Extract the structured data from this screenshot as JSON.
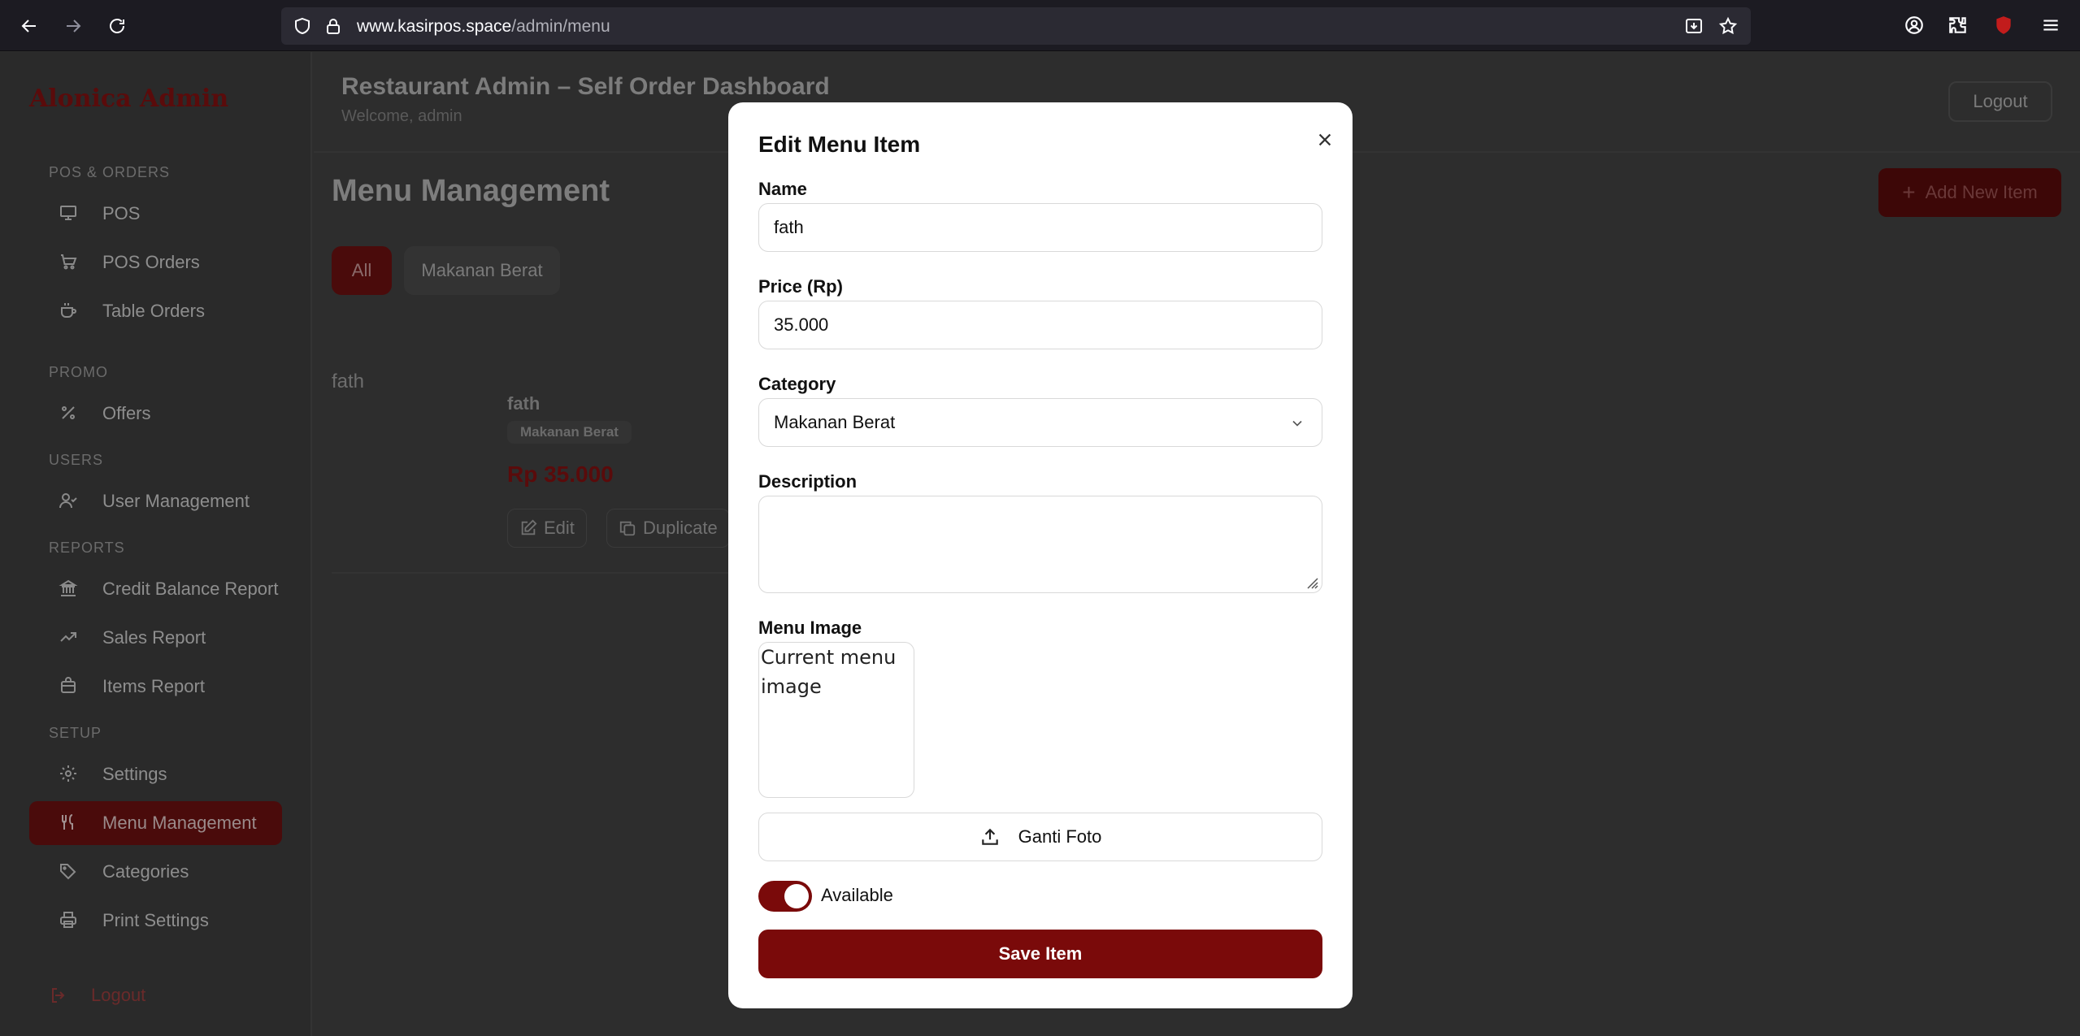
{
  "browser": {
    "url_host": "www.kasirpos.space",
    "url_path": "/admin/menu"
  },
  "sidebar": {
    "brand": "Alonica Admin",
    "sections": {
      "pos_orders": "POS & ORDERS",
      "promo": "PROMO",
      "users": "USERS",
      "reports": "REPORTS",
      "setup": "SETUP"
    },
    "items": {
      "pos": "POS",
      "pos_orders": "POS Orders",
      "table_orders": "Table Orders",
      "offers": "Offers",
      "user_management": "User Management",
      "credit_balance_report": "Credit Balance Report",
      "sales_report": "Sales Report",
      "items_report": "Items Report",
      "settings": "Settings",
      "menu_management": "Menu Management",
      "categories": "Categories",
      "print_settings": "Print Settings"
    },
    "logout": "Logout"
  },
  "header": {
    "title": "Restaurant Admin – Self Order Dashboard",
    "subtitle": "Welcome, admin",
    "logout": "Logout"
  },
  "main": {
    "title": "Menu Management",
    "add_button": "Add New Item",
    "filters": [
      "All",
      "Makanan Berat"
    ],
    "card": {
      "image_alt": "fath",
      "name": "fath",
      "category": "Makanan Berat",
      "price": "Rp 35.000",
      "edit": "Edit",
      "duplicate": "Duplicate"
    }
  },
  "modal": {
    "title": "Edit Menu Item",
    "name_label": "Name",
    "name_value": "fath",
    "price_label": "Price (Rp)",
    "price_value": "35.000",
    "category_label": "Category",
    "category_value": "Makanan Berat",
    "description_label": "Description",
    "description_value": "",
    "image_label": "Menu Image",
    "image_alt": "Current menu image",
    "upload_button": "Ganti Foto",
    "available_label": "Available",
    "available": true,
    "save_button": "Save Item"
  },
  "colors": {
    "accent": "#7a0a0a",
    "overlay_bg": "#2d2d2d"
  }
}
